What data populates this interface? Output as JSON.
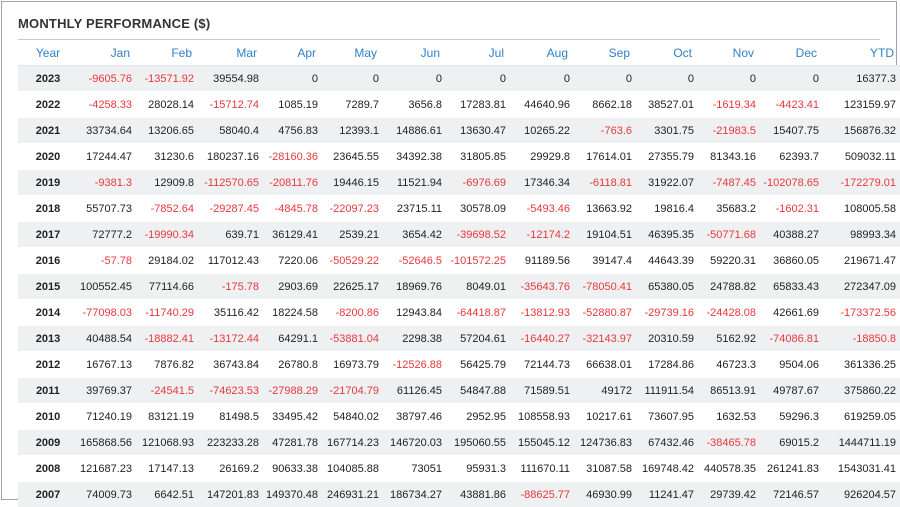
{
  "title": "MONTHLY PERFORMANCE ($)",
  "colors": {
    "header": "#2f80c7",
    "negative": "#e8373b",
    "stripe": "#eef0f2"
  },
  "columns": [
    "Year",
    "Jan",
    "Feb",
    "Mar",
    "Apr",
    "May",
    "Jun",
    "Jul",
    "Aug",
    "Sep",
    "Oct",
    "Nov",
    "Dec",
    "YTD"
  ],
  "rows": [
    [
      "2023",
      "-9605.76",
      "-13571.92",
      "39554.98",
      "0",
      "0",
      "0",
      "0",
      "0",
      "0",
      "0",
      "0",
      "0",
      "16377.3"
    ],
    [
      "2022",
      "-4258.33",
      "28028.14",
      "-15712.74",
      "1085.19",
      "7289.7",
      "3656.8",
      "17283.81",
      "44640.96",
      "8662.18",
      "38527.01",
      "-1619.34",
      "-4423.41",
      "123159.97"
    ],
    [
      "2021",
      "33734.64",
      "13206.65",
      "58040.4",
      "4756.83",
      "12393.1",
      "14886.61",
      "13630.47",
      "10265.22",
      "-763.6",
      "3301.75",
      "-21983.5",
      "15407.75",
      "156876.32"
    ],
    [
      "2020",
      "17244.47",
      "31230.6",
      "180237.16",
      "-28160.36",
      "23645.55",
      "34392.38",
      "31805.85",
      "29929.8",
      "17614.01",
      "27355.79",
      "81343.16",
      "62393.7",
      "509032.11"
    ],
    [
      "2019",
      "-9381.3",
      "12909.8",
      "-112570.65",
      "-20811.76",
      "19446.15",
      "11521.94",
      "-6976.69",
      "17346.34",
      "-6118.81",
      "31922.07",
      "-7487.45",
      "-102078.65",
      "-172279.01"
    ],
    [
      "2018",
      "55707.73",
      "-7852.64",
      "-29287.45",
      "-4845.78",
      "-22097.23",
      "23715.11",
      "30578.09",
      "-5493.46",
      "13663.92",
      "19816.4",
      "35683.2",
      "-1602.31",
      "108005.58"
    ],
    [
      "2017",
      "72777.2",
      "-19990.34",
      "639.71",
      "36129.41",
      "2539.21",
      "3654.42",
      "-39698.52",
      "-12174.2",
      "19104.51",
      "46395.35",
      "-50771.68",
      "40388.27",
      "98993.34"
    ],
    [
      "2016",
      "-57.78",
      "29184.02",
      "117012.43",
      "7220.06",
      "-50529.22",
      "-52646.5",
      "-101572.25",
      "91189.56",
      "39147.4",
      "44643.39",
      "59220.31",
      "36860.05",
      "219671.47"
    ],
    [
      "2015",
      "100552.45",
      "77114.66",
      "-175.78",
      "2903.69",
      "22625.17",
      "18969.76",
      "8049.01",
      "-35643.76",
      "-78050.41",
      "65380.05",
      "24788.82",
      "65833.43",
      "272347.09"
    ],
    [
      "2014",
      "-77098.03",
      "-11740.29",
      "35116.42",
      "18224.58",
      "-8200.86",
      "12943.84",
      "-64418.87",
      "-13812.93",
      "-52880.87",
      "-29739.16",
      "-24428.08",
      "42661.69",
      "-173372.56"
    ],
    [
      "2013",
      "40488.54",
      "-18882.41",
      "-13172.44",
      "64291.1",
      "-53881.04",
      "2298.38",
      "57204.61",
      "-16440.27",
      "-32143.97",
      "20310.59",
      "5162.92",
      "-74086.81",
      "-18850.8"
    ],
    [
      "2012",
      "16767.13",
      "7876.82",
      "36743.84",
      "26780.8",
      "16973.79",
      "-12526.88",
      "56425.79",
      "72144.73",
      "66638.01",
      "17284.86",
      "46723.3",
      "9504.06",
      "361336.25"
    ],
    [
      "2011",
      "39769.37",
      "-24541.5",
      "-74623.53",
      "-27988.29",
      "-21704.79",
      "61126.45",
      "54847.88",
      "71589.51",
      "49172",
      "111911.54",
      "86513.91",
      "49787.67",
      "375860.22"
    ],
    [
      "2010",
      "71240.19",
      "83121.19",
      "81498.5",
      "33495.42",
      "54840.02",
      "38797.46",
      "2952.95",
      "108558.93",
      "10217.61",
      "73607.95",
      "1632.53",
      "59296.3",
      "619259.05"
    ],
    [
      "2009",
      "165868.56",
      "121068.93",
      "223233.28",
      "47281.78",
      "167714.23",
      "146720.03",
      "195060.55",
      "155045.12",
      "124736.83",
      "67432.46",
      "-38465.78",
      "69015.2",
      "1444711.19"
    ],
    [
      "2008",
      "121687.23",
      "17147.13",
      "26169.2",
      "90633.38",
      "104085.88",
      "73051",
      "95931.3",
      "111670.11",
      "31087.58",
      "169748.42",
      "440578.35",
      "261241.83",
      "1543031.41"
    ],
    [
      "2007",
      "74009.73",
      "6642.51",
      "147201.83",
      "149370.48",
      "246931.21",
      "186734.27",
      "43881.86",
      "-88625.77",
      "46930.99",
      "11241.47",
      "29739.42",
      "72146.57",
      "926204.57"
    ]
  ]
}
